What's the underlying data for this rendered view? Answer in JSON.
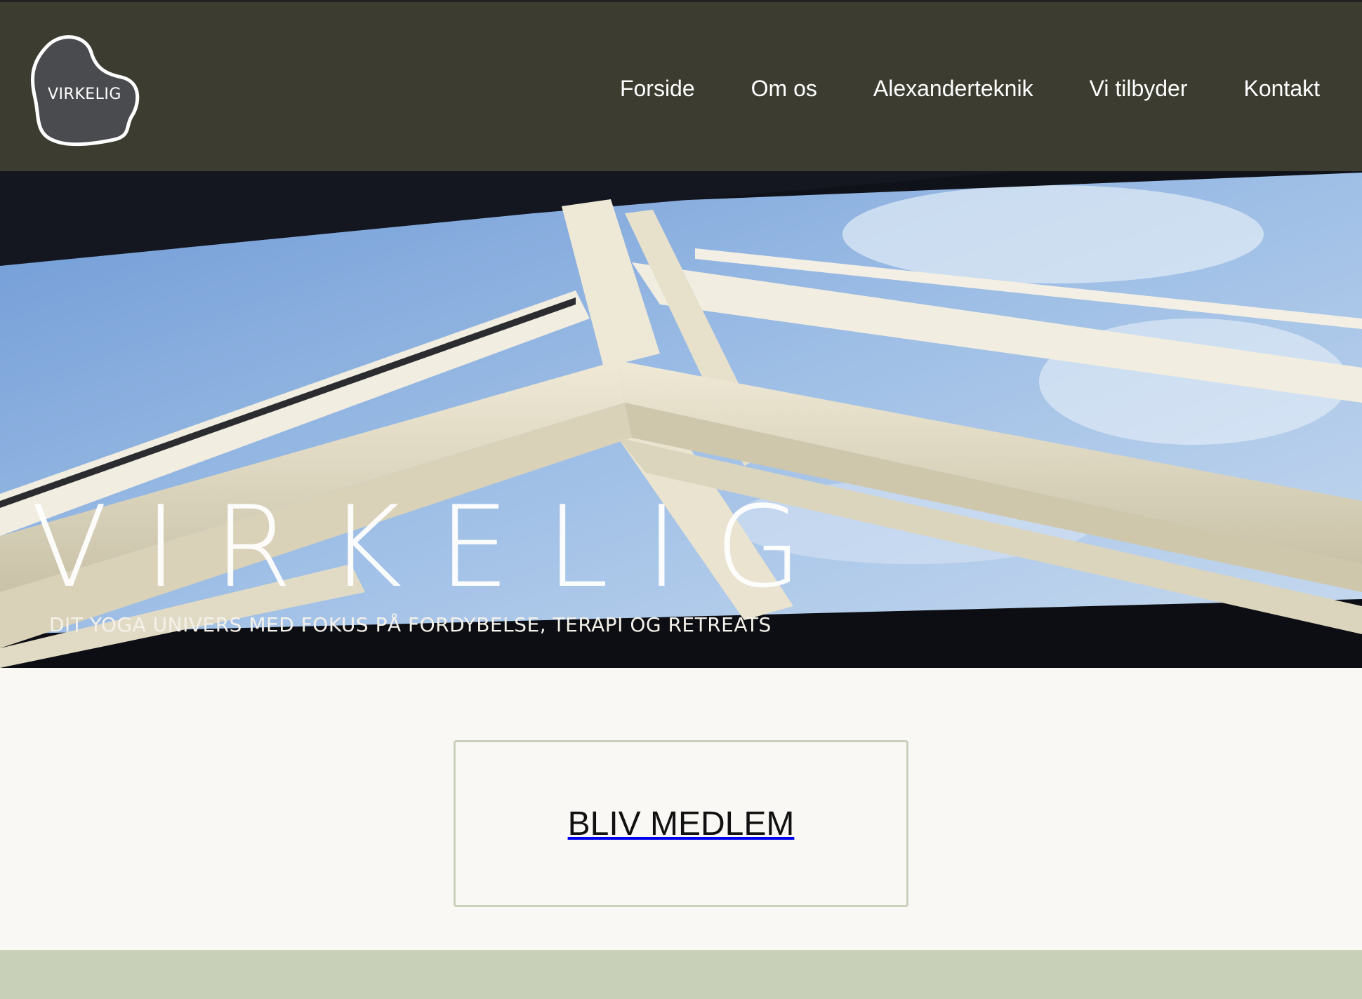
{
  "brand": {
    "logo_text": "VIRKELIG",
    "colors": {
      "header_bg": "#3c3d30",
      "accent": "#c8d1b8",
      "page_bg": "#f9f8f4"
    }
  },
  "nav": {
    "items": [
      {
        "label": "Forside"
      },
      {
        "label": "Om os"
      },
      {
        "label": "Alexanderteknik"
      },
      {
        "label": "Vi tilbyder"
      },
      {
        "label": "Kontakt"
      }
    ]
  },
  "hero": {
    "title": "VIRKELIG",
    "subtitle": "DIT YOGA UNIVERS MED FOKUS PÅ FORDYBELSE, TERAPI OG RETREATS"
  },
  "cta": {
    "label": "BLIV MEDLEM"
  }
}
